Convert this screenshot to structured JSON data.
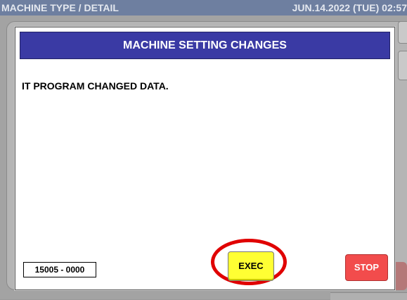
{
  "header": {
    "title": "MACHINE TYPE / DETAIL",
    "datetime": "JUN.14.2022 (TUE)  02:57"
  },
  "dialog": {
    "title": "MACHINE SETTING CHANGES",
    "message": "IT PROGRAM CHANGED DATA.",
    "code": "15005 - 0000",
    "exec_label": "EXEC",
    "stop_label": "STOP"
  },
  "colors": {
    "dialog_header": "#3a3aa4",
    "exec_button": "#ffff33",
    "stop_button": "#f24c4c",
    "highlight_ring": "#e00000"
  }
}
